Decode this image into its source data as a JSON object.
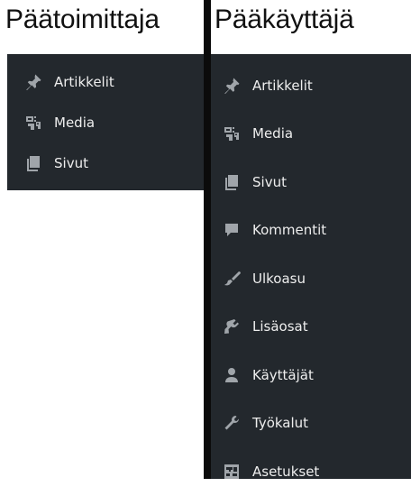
{
  "left_panel": {
    "title": "Päätoimittaja",
    "items": [
      {
        "label": "Artikkelit",
        "icon": "pushpin-icon"
      },
      {
        "label": "Media",
        "icon": "media-icon"
      },
      {
        "label": "Sivut",
        "icon": "pages-icon"
      }
    ]
  },
  "right_panel": {
    "title": "Pääkäyttäjä",
    "items": [
      {
        "label": "Artikkelit",
        "icon": "pushpin-icon"
      },
      {
        "label": "Media",
        "icon": "media-icon"
      },
      {
        "label": "Sivut",
        "icon": "pages-icon"
      },
      {
        "label": "Kommentit",
        "icon": "comment-icon"
      },
      {
        "label": "Ulkoasu",
        "icon": "paintbrush-icon"
      },
      {
        "label": "Lisäosat",
        "icon": "plugin-icon"
      },
      {
        "label": "Käyttäjät",
        "icon": "user-icon"
      },
      {
        "label": "Työkalut",
        "icon": "wrench-icon"
      },
      {
        "label": "Asetukset",
        "icon": "settings-icon"
      }
    ]
  },
  "colors": {
    "menu_background": "#23282d",
    "menu_text": "#eeeeee",
    "icon": "#a0a5aa",
    "divider": "#0b0b0b"
  }
}
